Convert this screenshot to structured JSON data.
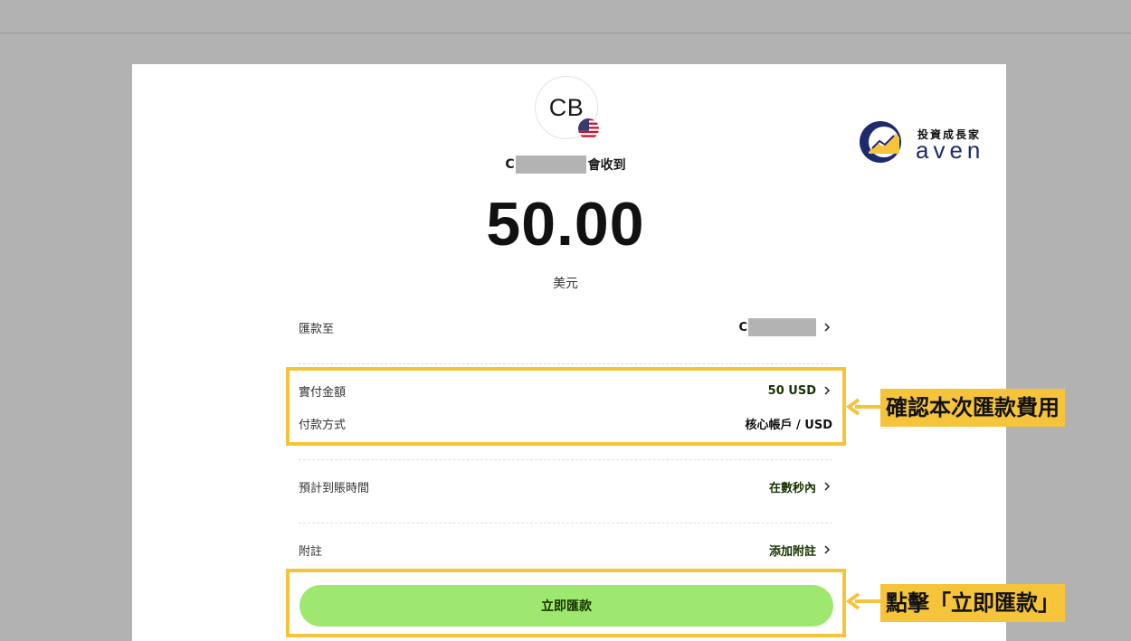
{
  "recipient": {
    "initials": "CB",
    "flag": "us-flag-icon",
    "name_prefix": "C",
    "receives_suffix": "會收到"
  },
  "amount": {
    "value": "50.00",
    "currency_label": "美元"
  },
  "details": {
    "transfer_to": {
      "label": "匯款至",
      "value_prefix": "C"
    },
    "actual_paid": {
      "label": "實付金額",
      "value": "50 USD"
    },
    "payment_method": {
      "label": "付款方式",
      "value": "核心帳戶 / USD"
    },
    "eta": {
      "label": "預計到賬時間",
      "value": "在數秒內"
    },
    "note": {
      "label": "附註",
      "value": "添加附註"
    }
  },
  "button": {
    "label": "立即匯款"
  },
  "callouts": {
    "fees": "確認本次匯款費用",
    "click": "點擊「立即匯款」"
  },
  "logo": {
    "chinese": "投資成長家",
    "english": "aven"
  },
  "colors": {
    "button_green": "#9fe870",
    "button_text": "#163300",
    "highlight_yellow": "#f6c43a",
    "background_gray": "#b2b2b2"
  }
}
